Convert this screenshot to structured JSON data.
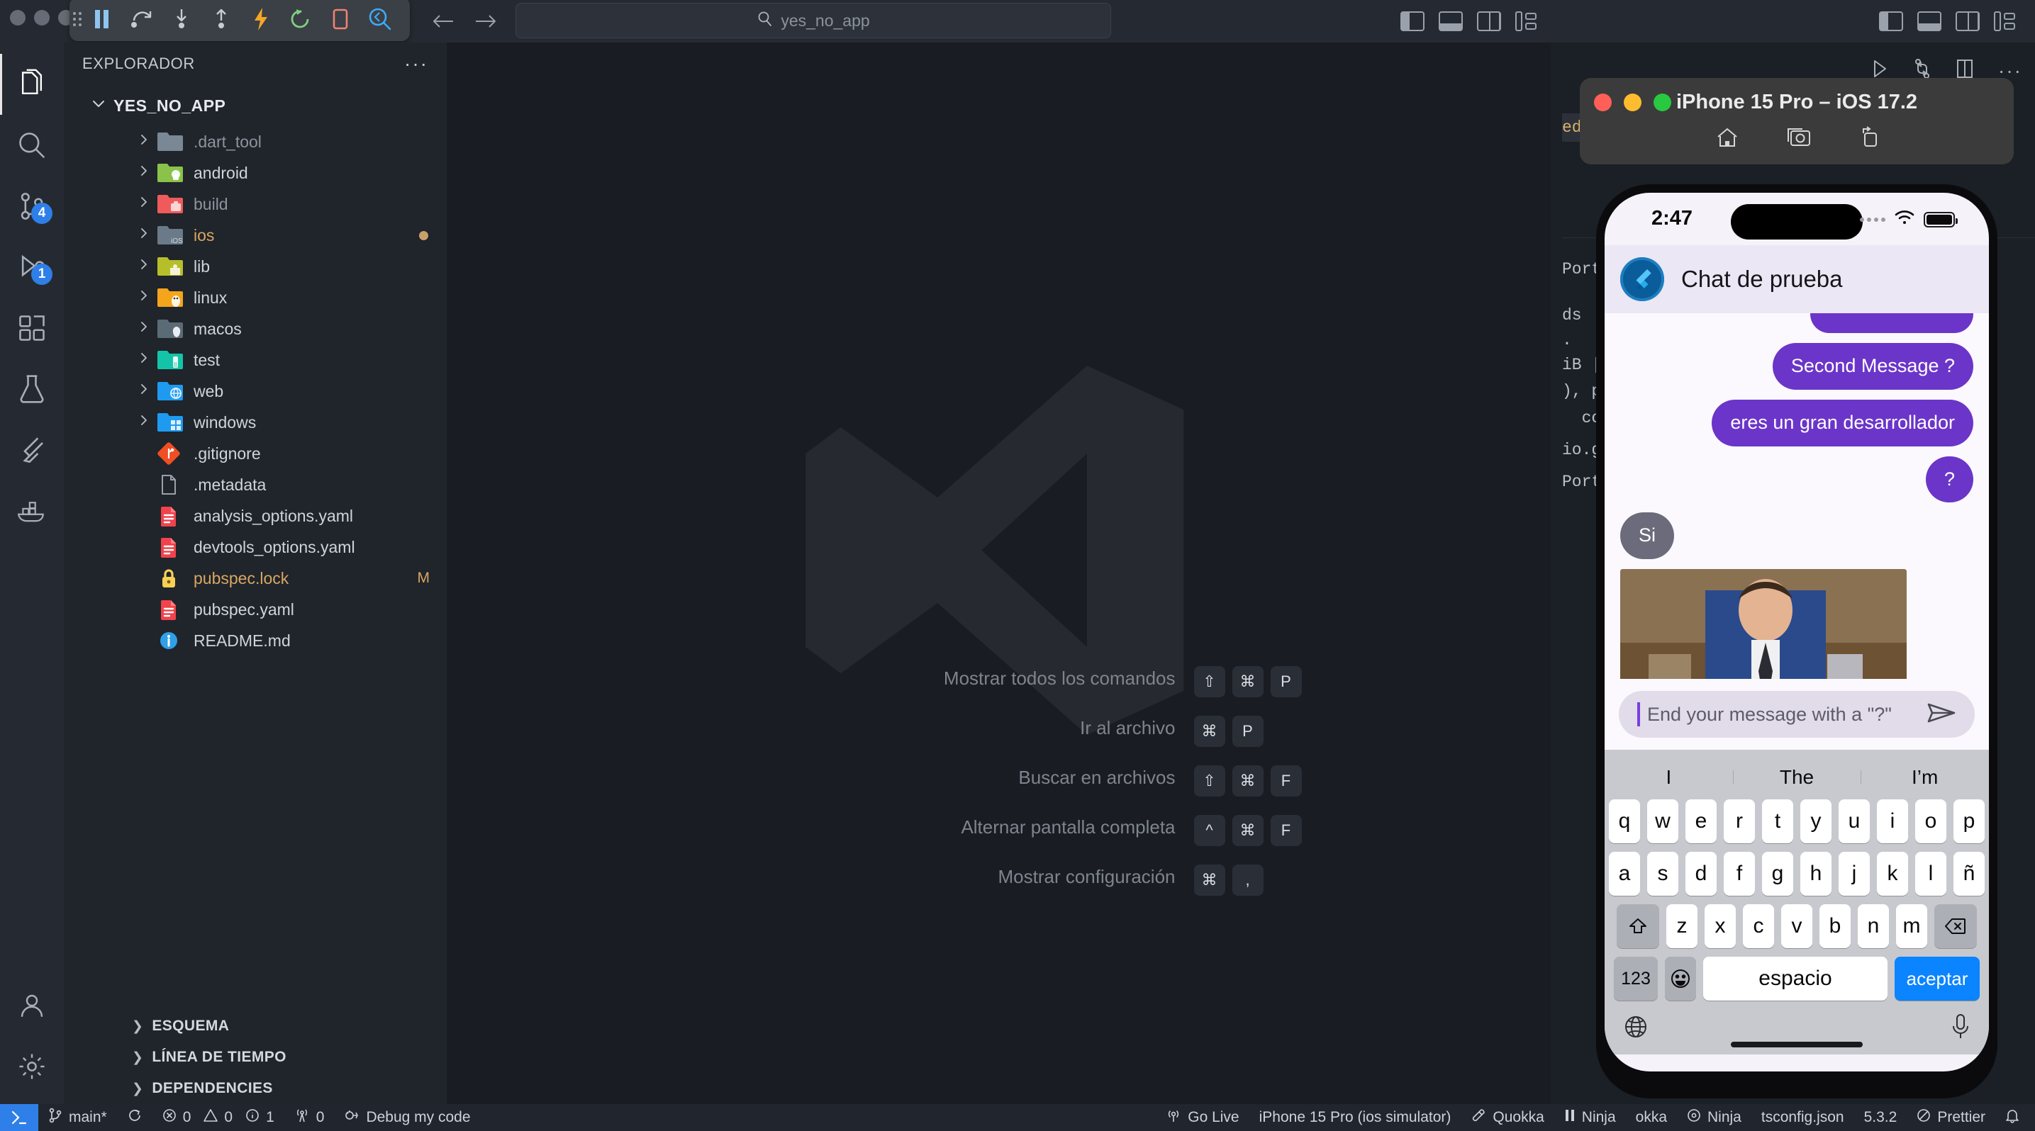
{
  "titlebar": {
    "search_value": "yes_no_app",
    "search_icon": "search-icon",
    "back_icon": "arrow-left-icon",
    "forward_icon": "arrow-right-icon",
    "flutter_tools": [
      {
        "name": "hot-reload-pause-icon",
        "label": "Pause"
      },
      {
        "name": "hot-restart-icon",
        "label": "Hot Restart"
      },
      {
        "name": "step-into-icon",
        "label": "Step Into"
      },
      {
        "name": "step-out-icon",
        "label": "Step Out"
      },
      {
        "name": "hot-reload-icon",
        "label": "Hot Reload"
      },
      {
        "name": "restart-icon",
        "label": "Restart"
      },
      {
        "name": "stop-icon",
        "label": "Stop"
      },
      {
        "name": "inspect-widget-icon",
        "label": "Inspect Widget"
      }
    ],
    "layout_icons": [
      "toggle-primary-sidebar-icon",
      "toggle-panel-icon",
      "toggle-secondary-sidebar-icon",
      "customize-layout-icon"
    ]
  },
  "activitybar": {
    "items": [
      {
        "name": "explorer",
        "icon": "files-icon",
        "badge": ""
      },
      {
        "name": "search",
        "icon": "search-icon",
        "badge": ""
      },
      {
        "name": "source-control",
        "icon": "source-control-icon",
        "badge": "4"
      },
      {
        "name": "run-and-debug",
        "icon": "run-debug-icon",
        "badge": "1"
      },
      {
        "name": "extensions",
        "icon": "extensions-icon",
        "badge": ""
      },
      {
        "name": "testing",
        "icon": "beaker-icon",
        "badge": ""
      },
      {
        "name": "flutter",
        "icon": "flutter-icon",
        "badge": ""
      },
      {
        "name": "docker",
        "icon": "docker-icon",
        "badge": ""
      }
    ],
    "bottom": [
      {
        "name": "accounts",
        "icon": "account-icon"
      },
      {
        "name": "manage",
        "icon": "gear-icon"
      }
    ]
  },
  "explorer": {
    "title": "EXPLORADOR",
    "more_actions": "···",
    "root": "YES_NO_APP",
    "items": [
      {
        "label": ".dart_tool",
        "type": "folder",
        "icon": "folder-dart-tool-icon",
        "color": "#7a8794",
        "dim": true,
        "status": ""
      },
      {
        "label": "android",
        "type": "folder",
        "icon": "folder-android-icon",
        "color": "#8bc34a",
        "dim": false,
        "status": ""
      },
      {
        "label": "build",
        "type": "folder",
        "icon": "folder-build-icon",
        "color": "#ef5b5b",
        "dim": true,
        "status": ""
      },
      {
        "label": "ios",
        "type": "folder",
        "icon": "folder-ios-icon",
        "color": "#6a7a88",
        "dim": false,
        "gold": true,
        "status": "dot"
      },
      {
        "label": "lib",
        "type": "folder",
        "icon": "folder-lib-icon",
        "color": "#b6bf2a",
        "dim": false,
        "status": ""
      },
      {
        "label": "linux",
        "type": "folder",
        "icon": "folder-linux-icon",
        "color": "#f4a51c",
        "dim": false,
        "status": ""
      },
      {
        "label": "macos",
        "type": "folder",
        "icon": "folder-macos-icon",
        "color": "#5b6b76",
        "dim": false,
        "status": ""
      },
      {
        "label": "test",
        "type": "folder",
        "icon": "folder-test-icon",
        "color": "#14c4a8",
        "dim": false,
        "status": ""
      },
      {
        "label": "web",
        "type": "folder",
        "icon": "folder-web-icon",
        "color": "#1e9bf0",
        "dim": false,
        "status": ""
      },
      {
        "label": "windows",
        "type": "folder",
        "icon": "folder-windows-icon",
        "color": "#1e9bf0",
        "dim": false,
        "status": ""
      },
      {
        "label": ".gitignore",
        "type": "file",
        "icon": "git-icon",
        "color": "#f04e23",
        "dim": false,
        "status": ""
      },
      {
        "label": ".metadata",
        "type": "file",
        "icon": "file-icon",
        "color": "#9aa1ab",
        "dim": false,
        "status": ""
      },
      {
        "label": "analysis_options.yaml",
        "type": "file",
        "icon": "yaml-icon",
        "color": "#f1434c",
        "dim": false,
        "status": ""
      },
      {
        "label": "devtools_options.yaml",
        "type": "file",
        "icon": "yaml-icon",
        "color": "#f1434c",
        "dim": false,
        "status": ""
      },
      {
        "label": "pubspec.lock",
        "type": "file",
        "icon": "lock-icon",
        "color": "#f7d154",
        "dim": false,
        "gold": true,
        "status": "M"
      },
      {
        "label": "pubspec.yaml",
        "type": "file",
        "icon": "yaml-icon",
        "color": "#f1434c",
        "dim": false,
        "status": ""
      },
      {
        "label": "README.md",
        "type": "file",
        "icon": "info-icon",
        "color": "#2f9fe8",
        "dim": false,
        "status": ""
      }
    ],
    "sections": [
      {
        "label": "ESQUEMA",
        "name": "outline"
      },
      {
        "label": "LÍNEA DE TIEMPO",
        "name": "timeline"
      },
      {
        "label": "DEPENDENCIES",
        "name": "dependencies"
      }
    ]
  },
  "editor": {
    "shortcuts": [
      {
        "label": "Mostrar todos los comandos",
        "keys": [
          "⇧",
          "⌘",
          "P"
        ]
      },
      {
        "label": "Ir al archivo",
        "keys": [
          "⌘",
          "P"
        ]
      },
      {
        "label": "Buscar en archivos",
        "keys": [
          "⇧",
          "⌘",
          "F"
        ]
      },
      {
        "label": "Alternar pantalla completa",
        "keys": [
          "^",
          "⌘",
          "F"
        ]
      },
      {
        "label": "Mostrar configuración",
        "keys": [
          "⌘",
          ","
        ]
      }
    ]
  },
  "rightpane": {
    "toolbar": [
      {
        "name": "run-icon",
        "glyph": "▷"
      },
      {
        "name": "split-terminal-icon",
        "glyph": ""
      },
      {
        "name": "split-editor-icon",
        "glyph": ""
      },
      {
        "name": "more-actions-icon",
        "glyph": "···"
      }
    ],
    "terminal_lines": [
      {
        "text": "ed c",
        "highlight": true
      },
      {
        "text": "Port"
      },
      {
        "text": "ds"
      },
      {
        "text": "."
      },
      {
        "text": "iB |"
      },
      {
        "text": "), p"
      },
      {
        "text": "  comp"
      },
      {
        "text": "io.git"
      },
      {
        "text": "Portfolio % █"
      }
    ]
  },
  "simulator": {
    "window_title": "iPhone 15 Pro – iOS 17.2",
    "traffic_colors": {
      "close": "#ff5f57",
      "minimize": "#febc2e",
      "zoom": "#28c840"
    },
    "tools": [
      {
        "name": "home-icon"
      },
      {
        "name": "screenshot-icon"
      },
      {
        "name": "rotate-icon"
      }
    ],
    "status": {
      "time": "2:47",
      "wifi_icon": "wifi-icon",
      "battery_icon": "battery-icon"
    },
    "app": {
      "title": "Chat de prueba",
      "logo": "flutter-logo-icon",
      "messages": [
        {
          "side": "right",
          "text": "",
          "kind": "partial"
        },
        {
          "side": "right",
          "text": "Second Message ?",
          "kind": "text"
        },
        {
          "side": "right",
          "text": "eres un gran desarrollador",
          "kind": "text"
        },
        {
          "side": "right",
          "text": "?",
          "kind": "text"
        },
        {
          "side": "left",
          "text": "Si",
          "kind": "text"
        },
        {
          "side": "left",
          "text": "",
          "kind": "image"
        }
      ],
      "input": {
        "placeholder": "End your message with a \"?\"",
        "value": "",
        "send_icon": "send-icon"
      },
      "accent": "#6b35c9"
    },
    "keyboard": {
      "predictions": [
        "I",
        "The",
        "I’m"
      ],
      "row1": [
        "q",
        "w",
        "e",
        "r",
        "t",
        "y",
        "u",
        "i",
        "o",
        "p"
      ],
      "row2": [
        "a",
        "s",
        "d",
        "f",
        "g",
        "h",
        "j",
        "k",
        "l",
        "ñ"
      ],
      "row3": [
        "z",
        "x",
        "c",
        "v",
        "b",
        "n",
        "m"
      ],
      "shift_icon": "shift-icon",
      "backspace_icon": "backspace-icon",
      "numbers_key": "123",
      "emoji_icon": "emoji-icon",
      "space_key": "espacio",
      "return_key": "aceptar",
      "globe_icon": "globe-icon",
      "mic_icon": "microphone-icon"
    }
  },
  "statusbar": {
    "remote_icon": "remote-window-icon",
    "left": [
      {
        "name": "branch",
        "icon": "git-branch-icon",
        "label": "main*"
      },
      {
        "name": "sync",
        "icon": "sync-icon",
        "label": ""
      },
      {
        "name": "errors",
        "icon": "error-icon",
        "label": "0"
      },
      {
        "name": "warnings",
        "icon": "warning-icon",
        "label": "0"
      },
      {
        "name": "infos",
        "icon": "info-icon",
        "label": "1"
      },
      {
        "name": "ports",
        "icon": "radio-tower-icon",
        "label": "0"
      },
      {
        "name": "debug-my-code",
        "icon": "debug-icon",
        "label": "Debug my code"
      }
    ],
    "right": [
      {
        "name": "go-live",
        "icon": "broadcast-icon",
        "label": "Go Live"
      },
      {
        "name": "device",
        "icon": "",
        "label": "iPhone 15 Pro (ios simulator)"
      },
      {
        "name": "quokka",
        "icon": "quokka-icon",
        "label": "Quokka"
      },
      {
        "name": "ninja-pause",
        "icon": "pause-icon",
        "label": "Ninja"
      },
      {
        "name": "quokka-2",
        "icon": "",
        "label": "okka"
      },
      {
        "name": "ninja",
        "icon": "circle-icon",
        "label": "Ninja"
      },
      {
        "name": "tsconfig",
        "icon": "",
        "label": "tsconfig.json"
      },
      {
        "name": "ts-version",
        "icon": "",
        "label": "5.3.2"
      },
      {
        "name": "prettier",
        "icon": "prettier-icon",
        "label": "Prettier"
      },
      {
        "name": "notifications",
        "icon": "bell-icon",
        "label": ""
      }
    ]
  }
}
